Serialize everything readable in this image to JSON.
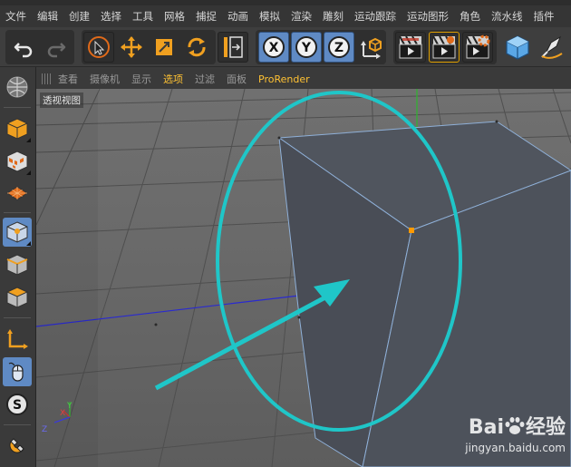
{
  "menubar": {
    "items": [
      "文件",
      "编辑",
      "创建",
      "选择",
      "工具",
      "网格",
      "捕捉",
      "动画",
      "模拟",
      "渲染",
      "雕刻",
      "运动跟踪",
      "运动图形",
      "角色",
      "流水线",
      "插件"
    ]
  },
  "toolbar": {
    "axis_x": "X",
    "axis_y": "Y",
    "axis_z": "Z"
  },
  "viewport_menu": {
    "items": [
      "查看",
      "摄像机",
      "显示",
      "选项",
      "过滤",
      "面板",
      "ProRender"
    ],
    "active": "选项"
  },
  "viewport": {
    "label": "透视视图",
    "axis_labels": {
      "y": "Y",
      "x": "X",
      "z": "Z"
    }
  },
  "watermark": {
    "logo_left": "Bai",
    "logo_right": "经验",
    "url": "jingyan.baidu.com"
  },
  "colors": {
    "highlight_ellipse": "#1fc6c8",
    "arrow": "#1fc6c8",
    "selected_button": "#5f8ac4",
    "active_menu": "#ffc233",
    "cube_face": "#4d525c",
    "vertex": "#ff9a00"
  },
  "icons": [
    "undo-icon",
    "redo-icon",
    "live-select-icon",
    "move-icon",
    "scale-icon",
    "rotate-icon",
    "coord-system-icon",
    "axis-lock-icon",
    "world-coord-icon",
    "render-view-icon",
    "render-picture-icon",
    "render-settings-icon",
    "cube-primitive-icon",
    "pen-icon"
  ]
}
